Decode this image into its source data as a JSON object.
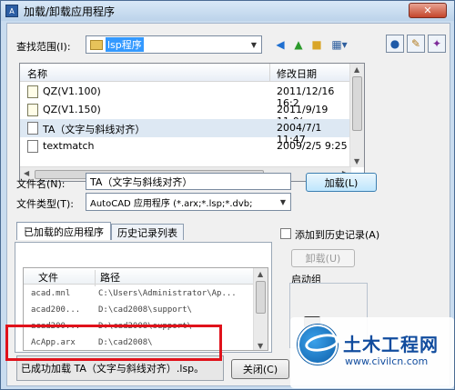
{
  "window": {
    "title": "加载/卸载应用程序",
    "close_glyph": "✕"
  },
  "lookin": {
    "label": "查找范围(I):",
    "value": "lsp程序"
  },
  "file_list": {
    "columns": [
      "名称",
      "修改日期"
    ],
    "rows": [
      {
        "name": "QZ(V1.100)",
        "date": "2011/12/16 16:2",
        "icon": "lisp-file-icon"
      },
      {
        "name": "QZ(V1.150)",
        "date": "2011/9/19 11:0(",
        "icon": "lisp-file-icon"
      },
      {
        "name": "TA（文字与斜线对齐）",
        "date": "2004/7/1 11:47",
        "icon": "document-icon",
        "selected": true
      },
      {
        "name": "textmatch",
        "date": "2009/2/5 9:25",
        "icon": "document-icon"
      }
    ]
  },
  "filename": {
    "label": "文件名(N):",
    "value": "TA（文字与斜线对齐）"
  },
  "filetype": {
    "label": "文件类型(T):",
    "value": "AutoCAD 应用程序 (*.arx;*.lsp;*.dvb;"
  },
  "load_button": "加载(L)",
  "tabs": [
    "已加载的应用程序",
    "历史记录列表"
  ],
  "loaded_list": {
    "columns": [
      "文件",
      "路径"
    ],
    "rows": [
      {
        "file": "acad.mnl",
        "path": "C:\\Users\\Administrator\\Ap..."
      },
      {
        "file": "acad200...",
        "path": "D:\\cad2008\\support\\"
      },
      {
        "file": "acad200...",
        "path": "D:\\cad2008\\support\\"
      },
      {
        "file": "AcApp.arx",
        "path": "D:\\cad2008\\"
      }
    ]
  },
  "add_history": {
    "label": "添加到历史记录(A)",
    "checked": false
  },
  "unload_button": "卸载(U)",
  "startup_label": "启动组",
  "status_text": "已成功加载 TA（文字与斜线对齐）.lsp。",
  "close_button": "关闭(C)",
  "watermark": {
    "title": "土木工程网",
    "url": "www.civilcn.com"
  },
  "colors": {
    "highlight": "#e0121b",
    "accent": "#3399ff",
    "watermark": "#114c9e"
  }
}
